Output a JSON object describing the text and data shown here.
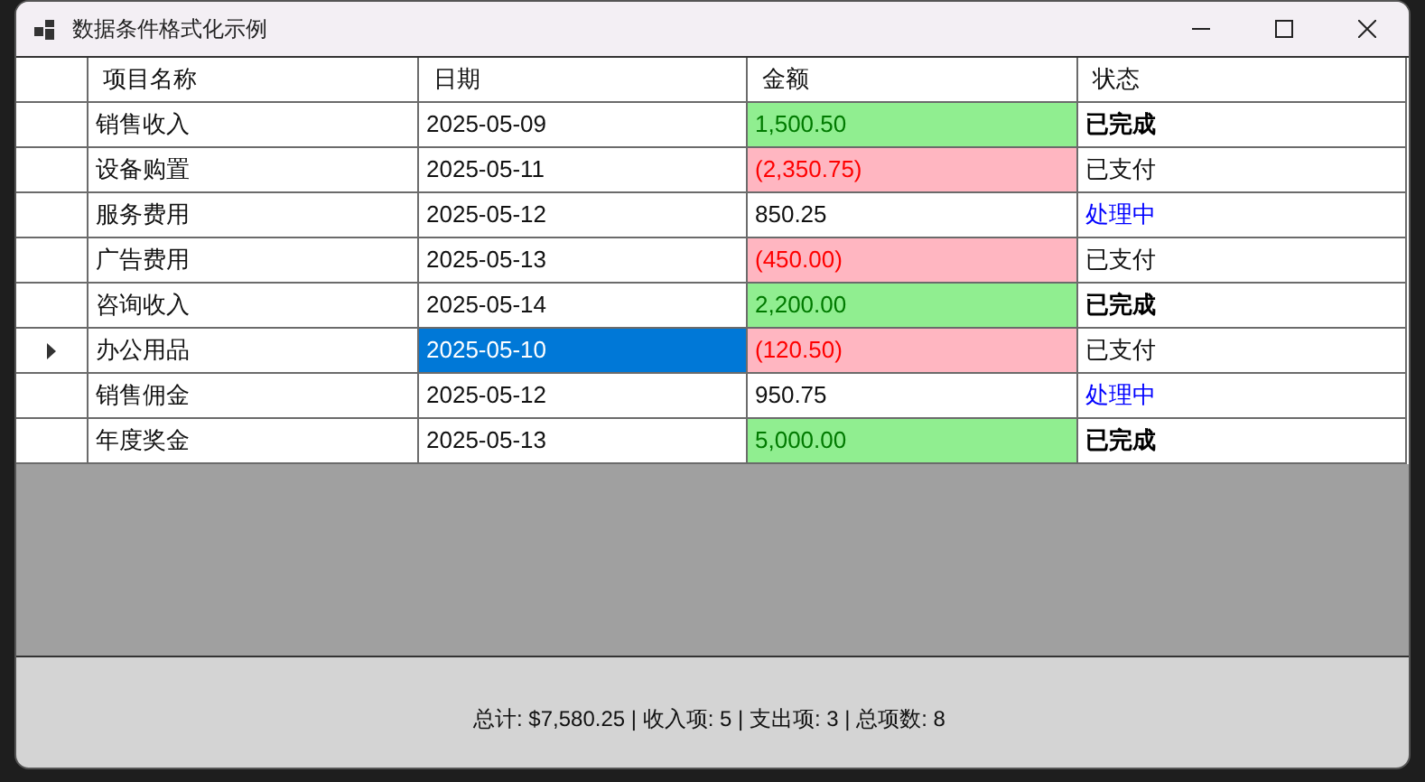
{
  "window": {
    "title": "数据条件格式化示例"
  },
  "table": {
    "columns": [
      "项目名称",
      "日期",
      "金额",
      "状态"
    ],
    "rows": [
      {
        "name": "销售收入",
        "date": "2025-05-09",
        "amount": {
          "text": "1,500.50",
          "kind": "income"
        },
        "status": {
          "text": "已完成",
          "kind": "done"
        },
        "selected": false
      },
      {
        "name": "设备购置",
        "date": "2025-05-11",
        "amount": {
          "text": "(2,350.75)",
          "kind": "expense"
        },
        "status": {
          "text": "已支付",
          "kind": "paid"
        },
        "selected": false
      },
      {
        "name": "服务费用",
        "date": "2025-05-12",
        "amount": {
          "text": "850.25",
          "kind": "neutral"
        },
        "status": {
          "text": "处理中",
          "kind": "processing"
        },
        "selected": false
      },
      {
        "name": "广告费用",
        "date": "2025-05-13",
        "amount": {
          "text": "(450.00)",
          "kind": "expense"
        },
        "status": {
          "text": "已支付",
          "kind": "paid"
        },
        "selected": false
      },
      {
        "name": "咨询收入",
        "date": "2025-05-14",
        "amount": {
          "text": "2,200.00",
          "kind": "income"
        },
        "status": {
          "text": "已完成",
          "kind": "done"
        },
        "selected": false
      },
      {
        "name": "办公用品",
        "date": "2025-05-10",
        "amount": {
          "text": "(120.50)",
          "kind": "expense"
        },
        "status": {
          "text": "已支付",
          "kind": "paid"
        },
        "selected": true
      },
      {
        "name": "销售佣金",
        "date": "2025-05-12",
        "amount": {
          "text": "950.75",
          "kind": "neutral"
        },
        "status": {
          "text": "处理中",
          "kind": "processing"
        },
        "selected": false
      },
      {
        "name": "年度奖金",
        "date": "2025-05-13",
        "amount": {
          "text": "5,000.00",
          "kind": "income"
        },
        "status": {
          "text": "已完成",
          "kind": "done"
        },
        "selected": false
      }
    ]
  },
  "status_bar": {
    "summary": "总计: $7,580.25 | 收入项: 5 | 支出项: 3 | 总项数: 8"
  }
}
